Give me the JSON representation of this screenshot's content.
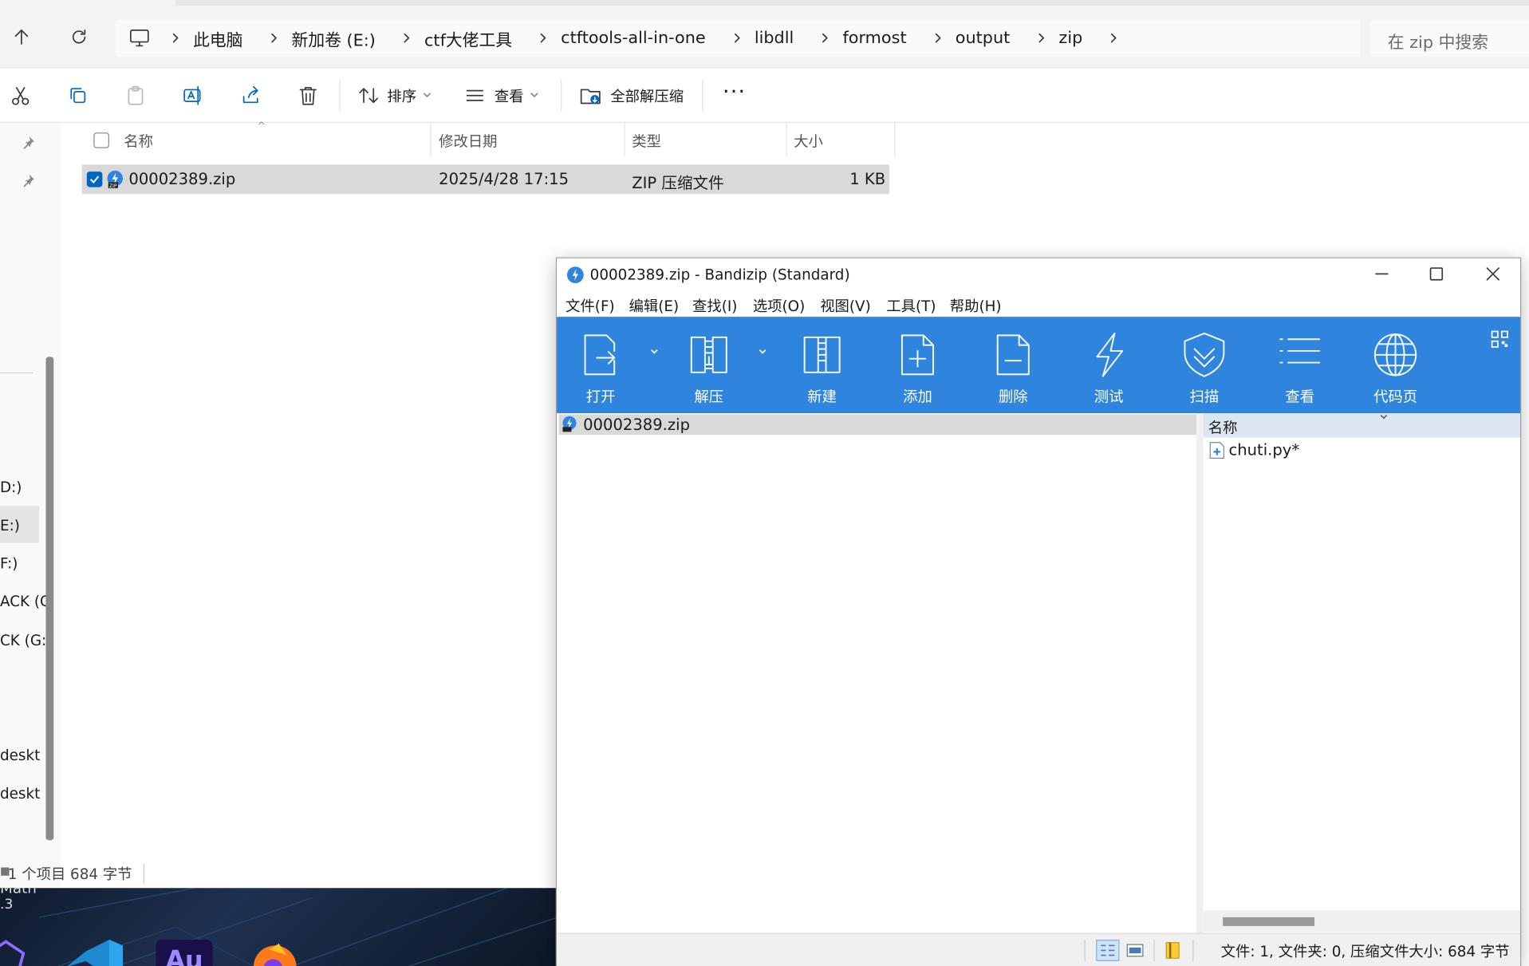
{
  "explorer": {
    "breadcrumbs": [
      "此电脑",
      "新加卷 (E:)",
      "ctf大佬工具",
      "ctftools-all-in-one",
      "libdll",
      "formost",
      "output",
      "zip"
    ],
    "search_placeholder": "在 zip 中搜索",
    "commands": {
      "sort": "排序",
      "view": "查看",
      "extract_all": "全部解压缩"
    },
    "columns": [
      "名称",
      "修改日期",
      "类型",
      "大小"
    ],
    "files": [
      {
        "name": "00002389.zip",
        "modified": "2025/4/28 17:15",
        "type": "ZIP 压缩文件",
        "size": "1 KB"
      }
    ],
    "nav_items": [
      "D:)",
      "E:)",
      "F:)",
      "ACK (G",
      "CK (G:)",
      "deskt",
      "deskt"
    ],
    "status": {
      "count": "1 个项目",
      "size": "684 字节"
    },
    "taskbar_fragments": [
      "Math",
      ".3"
    ]
  },
  "bandizip": {
    "title": "00002389.zip - Bandizip (Standard)",
    "menu": [
      "文件(F)",
      "编辑(E)",
      "查找(I)",
      "选项(O)",
      "视图(V)",
      "工具(T)",
      "帮助(H)"
    ],
    "toolbar": [
      {
        "label": "打开",
        "icon": "open-icon"
      },
      {
        "label": "解压",
        "icon": "extract-icon"
      },
      {
        "label": "新建",
        "icon": "new-archive-icon"
      },
      {
        "label": "添加",
        "icon": "add-file-icon"
      },
      {
        "label": "删除",
        "icon": "delete-file-icon"
      },
      {
        "label": "测试",
        "icon": "lightning-icon"
      },
      {
        "label": "扫描",
        "icon": "shield-icon"
      },
      {
        "label": "查看",
        "icon": "list-icon"
      },
      {
        "label": "代码页",
        "icon": "globe-icon"
      }
    ],
    "tree_item": "00002389.zip",
    "list_header": "名称",
    "list_items": [
      "chuti.py*"
    ],
    "status_text": "文件: 1, 文件夹: 0, 压缩文件大小: 684 字节"
  },
  "colors": {
    "toolbar_blue": "#2f84de",
    "selection_gray": "#d9d9d9",
    "accent": "#0067c0"
  }
}
